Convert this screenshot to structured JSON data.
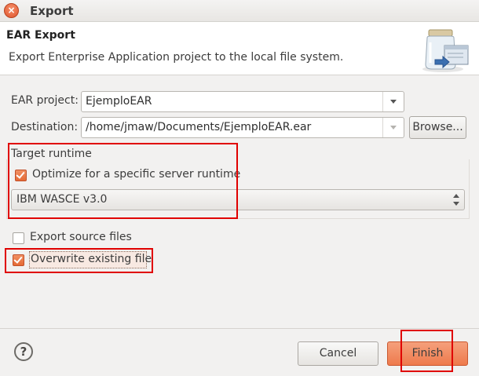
{
  "window": {
    "title": "Export"
  },
  "banner": {
    "title": "EAR Export",
    "description": "Export Enterprise Application project to the local file system."
  },
  "form": {
    "ear_project_label": "EAR project:",
    "ear_project_value": "EjemploEAR",
    "destination_label": "Destination:",
    "destination_value": "/home/jmaw/Documents/EjemploEAR.ear",
    "browse_label": "Browse..."
  },
  "target_runtime": {
    "group_label": "Target runtime",
    "optimize_label": "Optimize for a specific server runtime",
    "optimize_checked": true,
    "runtime_value": "IBM WASCE v3.0"
  },
  "options": {
    "export_source_label": "Export source files",
    "export_source_checked": false,
    "overwrite_label": "Overwrite existing file",
    "overwrite_checked": true
  },
  "footer": {
    "help_glyph": "?",
    "cancel_label": "Cancel",
    "finish_label": "Finish"
  },
  "colors": {
    "accent": "#ee7a4c",
    "highlight_box": "#e00000"
  },
  "icons": [
    "close-icon",
    "jar-export-icon",
    "help-icon",
    "chevron-down-icon",
    "updown-arrows-icon",
    "checkmark-icon"
  ]
}
